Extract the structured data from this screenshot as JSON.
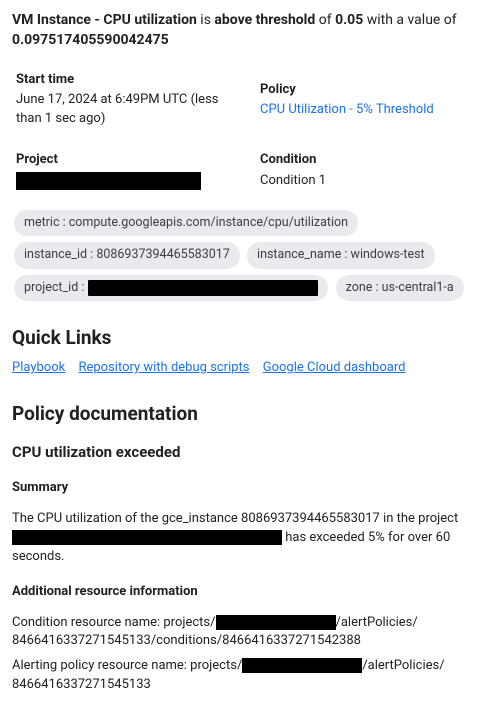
{
  "headline": {
    "p1": "VM Instance - CPU utilization",
    "p2": " is ",
    "p3": "above threshold",
    "p4": " of ",
    "p5": "0.05",
    "p6": " with a value of ",
    "p7": "0.097517405590042475"
  },
  "meta": {
    "start_label": "Start time",
    "start_val": "June 17, 2024 at 6:49PM UTC (less than 1 sec ago)",
    "policy_label": "Policy",
    "policy_val": "CPU Utilization - 5% Threshold",
    "project_label": "Project",
    "condition_label": "Condition",
    "condition_val": "Condition 1"
  },
  "chips": {
    "metric": "metric : compute.googleapis.com/instance/cpu/utilization",
    "instance_id": "instance_id : 8086937394465583017",
    "instance_name": "instance_name : windows-test",
    "project_id_prefix": "project_id :",
    "zone": "zone : us-central1-a"
  },
  "quick": {
    "heading": "Quick Links",
    "playbook": "Playbook",
    "repo": "Repository with debug scripts",
    "dash": "Google Cloud dashboard"
  },
  "doc": {
    "heading": "Policy documentation",
    "sub": "CPU utilization exceeded",
    "summary_h": "Summary",
    "summary_pre": "The CPU utilization of the gce_instance 8086937394465583017 in the project ",
    "summary_post": " has exceeded 5% for over 60 seconds.",
    "addl_h": "Additional resource information",
    "cond_pre": "Condition resource name: projects/",
    "cond_mid": "/alertPolicies/",
    "cond_post": "8466416337271545133/conditions/8466416337271542388",
    "pol_pre": "Alerting policy resource name: projects/",
    "pol_mid": "/alertPolicies/",
    "pol_post": "8466416337271545133"
  }
}
